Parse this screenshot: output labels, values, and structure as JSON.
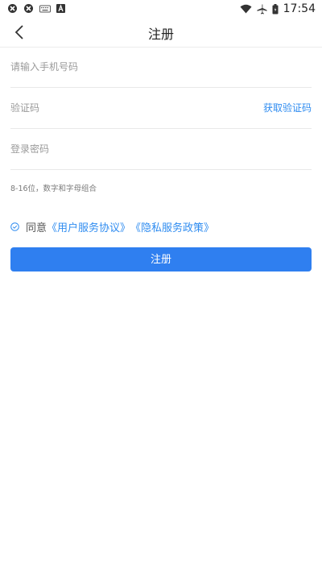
{
  "status_bar": {
    "time": "17:54",
    "icons_left": [
      "app-icon",
      "app-icon",
      "keyboard-icon",
      "font-icon"
    ],
    "icons_right": [
      "wifi-icon",
      "airplane-icon",
      "battery-icon"
    ]
  },
  "nav": {
    "title": "注册",
    "back_icon": "chevron-left-icon"
  },
  "form": {
    "phone_placeholder": "请输入手机号码",
    "code_placeholder": "验证码",
    "get_code_label": "获取验证码",
    "password_placeholder": "登录密码",
    "password_hint": "8-16位，数字和字母组合"
  },
  "agreement": {
    "prefix": "同意",
    "user_agreement": "《用户服务协议》",
    "privacy_policy": "《隐私服务政策》"
  },
  "submit": {
    "label": "注册"
  },
  "colors": {
    "accent": "#2f7ff0",
    "link": "#2f8cf0",
    "placeholder": "#9a9a9a",
    "divider": "#e9e9e9"
  }
}
